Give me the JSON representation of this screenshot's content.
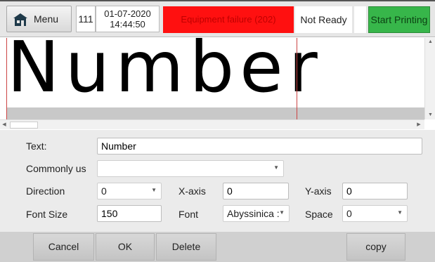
{
  "header": {
    "menu_label": "Menu",
    "counter": "111",
    "date": "01-07-2020",
    "time": "14:44:50",
    "alarm": "Equipment failure (202)",
    "status": "Not Ready",
    "start_label": "Start Printing"
  },
  "preview": {
    "text": "Number"
  },
  "form": {
    "text_label": "Text:",
    "text_value": "Number",
    "common_label": "Commonly us",
    "common_value": "",
    "direction_label": "Direction",
    "direction_value": "0",
    "xaxis_label": "X-axis",
    "xaxis_value": "0",
    "yaxis_label": "Y-axis",
    "yaxis_value": "0",
    "fontsize_label": "Font Size",
    "fontsize_value": "150",
    "font_label": "Font",
    "font_value": "Abyssinica :",
    "space_label": "Space",
    "space_value": "0"
  },
  "buttons": {
    "cancel": "Cancel",
    "ok": "OK",
    "delete": "Delete",
    "copy": "copy"
  },
  "colors": {
    "alarm_bg": "#ff1010",
    "start_bg": "#37b64a"
  },
  "icons": {
    "menu": "home-icon"
  }
}
